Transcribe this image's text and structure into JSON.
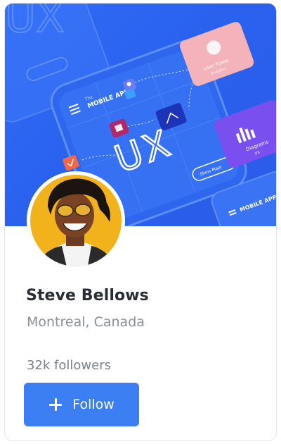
{
  "profile": {
    "name": "Steve Bellows",
    "location": "Montreal, Canada",
    "followers": "32k followers"
  },
  "actions": {
    "follow_label": "Follow",
    "follow_icon": "plus-icon"
  },
  "cover": {
    "phone_title": "MOBILE APP",
    "phone_small": "The",
    "phone_button": "Show Mapr",
    "corner_button": "Show Mapr",
    "pink_card_line1": "User Flows",
    "pink_card_line2": "Analytics",
    "purple_card_line1": "Diagrams",
    "purple_card_line2": "UX",
    "mini_phone_title": "MOBILE APP"
  },
  "colors": {
    "cover_bg": "#2f6cf5",
    "button_bg": "#3b7ff2",
    "name_text": "#2a2d34",
    "muted_text": "#8a8f98"
  }
}
